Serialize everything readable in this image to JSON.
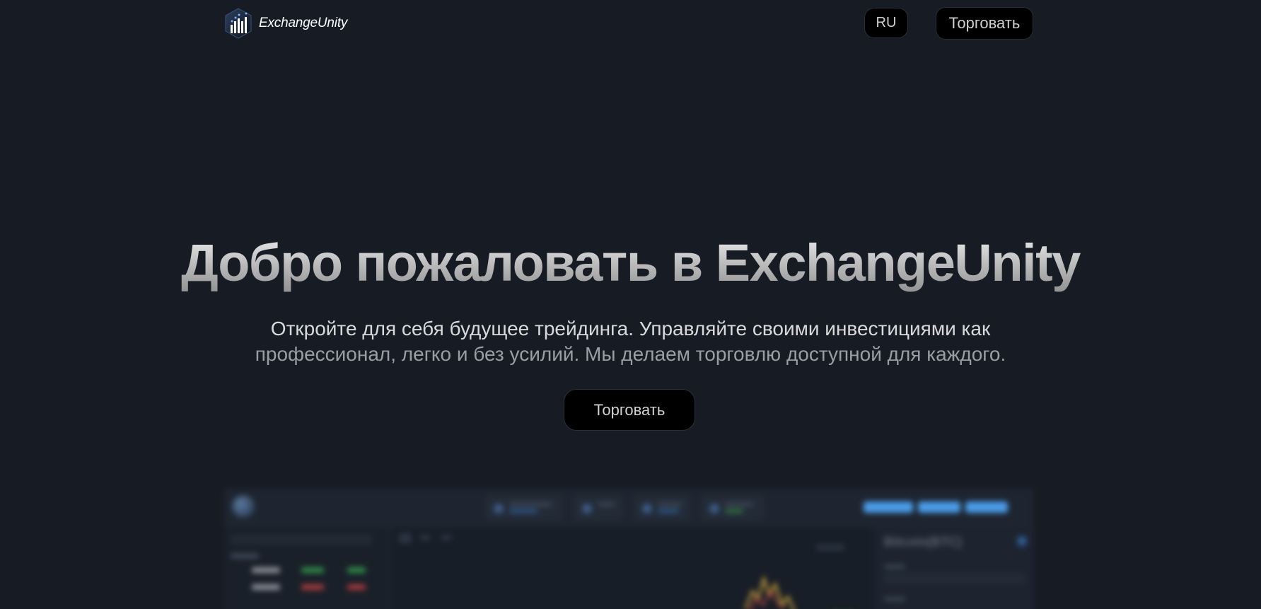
{
  "header": {
    "brand": "ExchangeUnity",
    "lang_label": "RU",
    "trade_label": "Торговать"
  },
  "hero": {
    "title": "Добро пожаловать в ExchangeUnity",
    "subtitle_line1": "Откройте для себя будущее трейдинга. Управляйте своими инвестициями как",
    "subtitle_line2": "профессионал, легко и без усилий. Мы делаем торговлю доступной для каждого.",
    "cta_label": "Торговать"
  },
  "preview": {
    "panel_title": "Bitcoin(BTC)"
  },
  "colors": {
    "background": "#171c24",
    "button_bg": "#000000",
    "accent_blue": "#4a9be8"
  }
}
